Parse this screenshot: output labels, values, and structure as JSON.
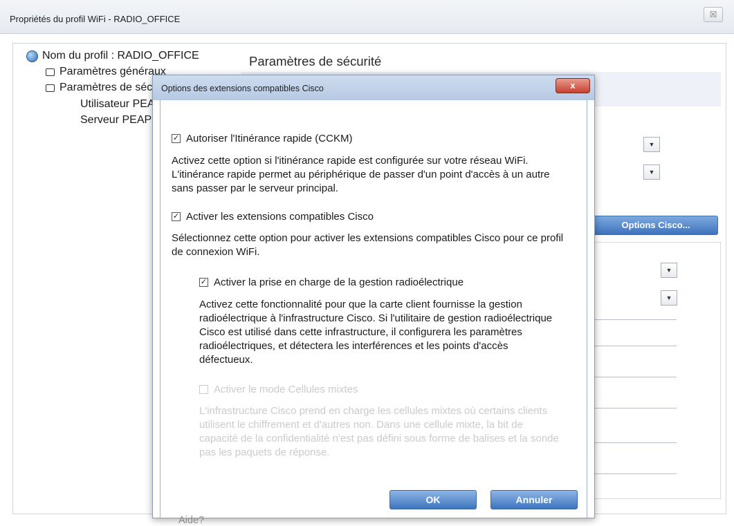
{
  "window": {
    "title": "Propriétés du profil WiFi - RADIO_OFFICE",
    "close_symbol": "☒"
  },
  "tree": {
    "root": "Nom du profil : RADIO_OFFICE",
    "items": [
      {
        "label": "Paramètres généraux",
        "icon": "general-settings-icon"
      },
      {
        "label": "Paramètres de sécurité",
        "icon": "security-settings-icon"
      }
    ],
    "subitems": [
      "Utilisateur PEAP",
      "Serveur PEAP"
    ]
  },
  "main": {
    "section_title": "Paramètres de sécurité",
    "options_cisco_button": "Options Cisco..."
  },
  "dialog": {
    "title": "Options des extensions compatibles Cisco",
    "close_symbol": "x",
    "options": [
      {
        "label": "Autoriser l'Itinérance rapide (CCKM)",
        "checked": true,
        "description": "Activez cette option si l'itinérance rapide est configurée sur votre réseau WiFi. L'itinérance rapide permet au périphérique de passer d'un point d'accès à un autre sans passer par le serveur principal."
      },
      {
        "label": "Activer les extensions compatibles Cisco",
        "checked": true,
        "description": "Sélectionnez cette option pour activer les extensions compatibles Cisco pour ce profil de connexion WiFi."
      },
      {
        "label": "Activer la prise en charge de la gestion radioélectrique",
        "checked": true,
        "description": "Activez cette fonctionnalité pour que la carte client fournisse la gestion radioélectrique à l'infrastructure Cisco. Si l'utilitaire de gestion radioélectrique Cisco est utilisé dans cette infrastructure, il configurera les paramètres radioélectriques, et détectera les interférences et les points d'accès défectueux."
      },
      {
        "label": "Activer le mode Cellules mixtes",
        "checked": false,
        "disabled": true,
        "description": "L'infrastructure Cisco prend en charge les cellules mixtes où certains clients utilisent le chiffrement et d'autres non. Dans une cellule mixte, la bit de capacité de la confidentialité n'est pas défini sous forme de balises et la sonde pas les paquets de réponse."
      }
    ],
    "help_link": "Aide?",
    "ok_button": "OK",
    "cancel_button": "Annuler"
  }
}
